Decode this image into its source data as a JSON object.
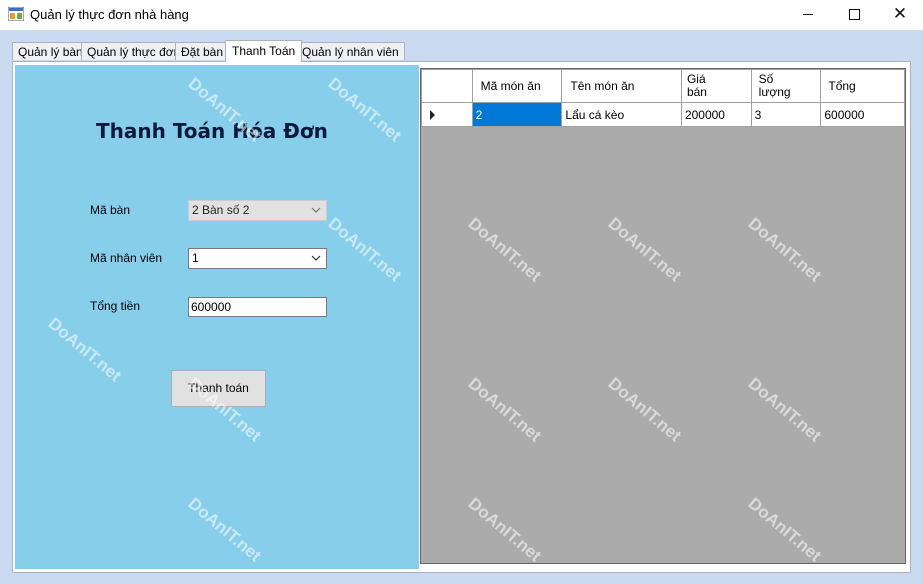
{
  "window": {
    "title": "Quản lý thực đơn nhà hàng",
    "minimize_icon": "minimize-icon",
    "maximize_icon": "maximize-icon",
    "close_icon": "close-icon"
  },
  "tabs": [
    {
      "label": "Quản lý bàn",
      "active": false
    },
    {
      "label": "Quản lý thực đơn",
      "active": false
    },
    {
      "label": "Đặt bàn",
      "active": false
    },
    {
      "label": "Thanh Toán",
      "active": true
    },
    {
      "label": "Quản lý nhân viên",
      "active": false
    }
  ],
  "form": {
    "heading": "Thanh Toán Hóa Đơn",
    "table_label": "Mã bàn",
    "table_value": "2 Bàn số 2",
    "employee_label": "Mã nhân viên",
    "employee_value": "1",
    "total_label": "Tổng tiền",
    "total_value": "600000",
    "pay_button": "Thanh toán"
  },
  "grid": {
    "columns": [
      "Mã món ăn",
      "Tên món ăn",
      "Giá\nbán",
      "Số\nlượng",
      "Tổng"
    ],
    "rows": [
      [
        "2",
        "Lẩu cá kèo",
        "200000",
        "3",
        "600000"
      ]
    ]
  },
  "watermark": "DoAnIT.net",
  "colors": {
    "panel": "#87ceeb",
    "grid_bg": "#ababab",
    "selection": "#0078d7"
  }
}
